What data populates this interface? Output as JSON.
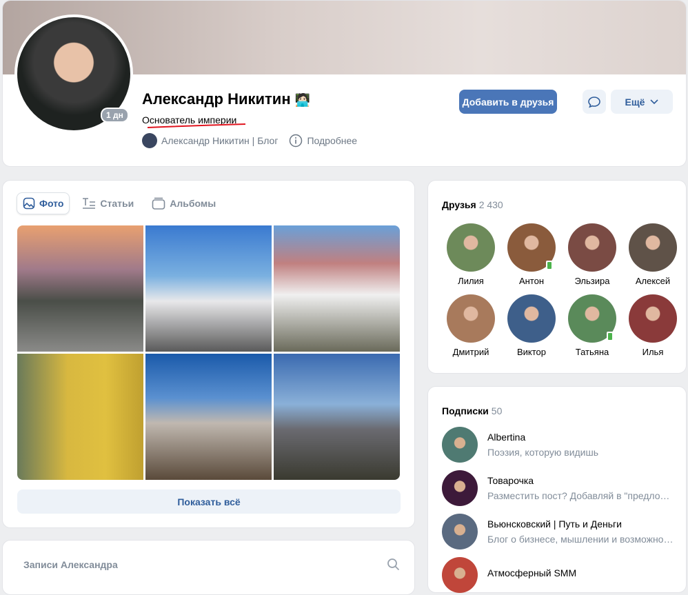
{
  "profile": {
    "name": "Александр Никитин",
    "emoji": "🧑🏻‍💻",
    "status": "Основатель империи",
    "last_seen": "1 дн",
    "blog_link": "Александр Никитин | Блог",
    "details": "Подробнее",
    "add_friend": "Добавить в друзья",
    "more": "Ещё"
  },
  "photos": {
    "tabs": [
      "Фото",
      "Статьи",
      "Альбомы"
    ],
    "show_all": "Показать всё"
  },
  "posts": {
    "placeholder": "Записи Александра"
  },
  "friends": {
    "title": "Друзья",
    "count": "2 430",
    "items": [
      {
        "name": "Лилия",
        "color": "#6d8a5a",
        "mobile": false
      },
      {
        "name": "Антон",
        "color": "#8a5b3c",
        "mobile": true
      },
      {
        "name": "Эльзира",
        "color": "#7a4b44",
        "mobile": false
      },
      {
        "name": "Алексей",
        "color": "#5f5248",
        "mobile": false
      },
      {
        "name": "Дмитрий",
        "color": "#a87a5c",
        "mobile": false
      },
      {
        "name": "Виктор",
        "color": "#3e5f8a",
        "mobile": false
      },
      {
        "name": "Татьяна",
        "color": "#5a8a5a",
        "mobile": true
      },
      {
        "name": "Илья",
        "color": "#8a3a3a",
        "mobile": false
      }
    ]
  },
  "subscriptions": {
    "title": "Подписки",
    "count": "50",
    "items": [
      {
        "name": "Albertina",
        "desc": "Поэзия, которую видишь",
        "color": "#4f7a72"
      },
      {
        "name": "Товарочка",
        "desc": "Разместить пост? Добавляй в \"предложку\"",
        "color": "#3d1a3a"
      },
      {
        "name": "Вьюнсковский | Путь и Деньги",
        "desc": "Блог о бизнесе, мышлении и возможностях",
        "color": "#5a6a80"
      },
      {
        "name": "Атмосферный SMM",
        "desc": "",
        "color": "#c0463a"
      }
    ]
  }
}
